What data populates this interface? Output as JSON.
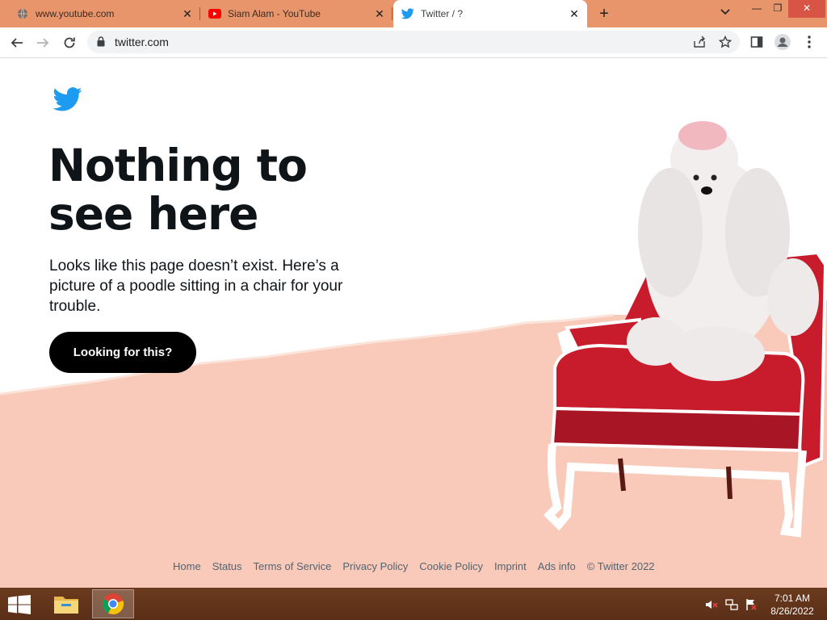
{
  "browser": {
    "tabs": [
      {
        "title": "www.youtube.com",
        "favicon": "globe-icon",
        "active": false
      },
      {
        "title": "Siam Alam - YouTube",
        "favicon": "youtube-icon",
        "active": false
      },
      {
        "title": "Twitter / ?",
        "favicon": "twitter-icon",
        "active": true
      }
    ],
    "url": "twitter.com",
    "colors": {
      "tabstrip": "#e8956b",
      "close_button": "#d85444"
    }
  },
  "page": {
    "headline": "Nothing to see here",
    "headline_line1": "Nothing to",
    "headline_line2": "see here",
    "subtext": "Looks like this page doesn’t exist. Here’s a picture of a poodle sitting in a chair for your trouble.",
    "cta_label": "Looking for this?",
    "footer_links": [
      "Home",
      "Status",
      "Terms of Service",
      "Privacy Policy",
      "Cookie Policy",
      "Imprint",
      "Ads info",
      "© Twitter 2022"
    ],
    "colors": {
      "twitter_blue": "#1d9bf0",
      "pink_bg": "#f9c9b9",
      "button_bg": "#000000",
      "chair_red": "#c81c2c"
    }
  },
  "taskbar": {
    "apps": [
      "file-explorer-icon",
      "chrome-icon"
    ],
    "time": "7:01 AM",
    "date": "8/26/2022"
  }
}
